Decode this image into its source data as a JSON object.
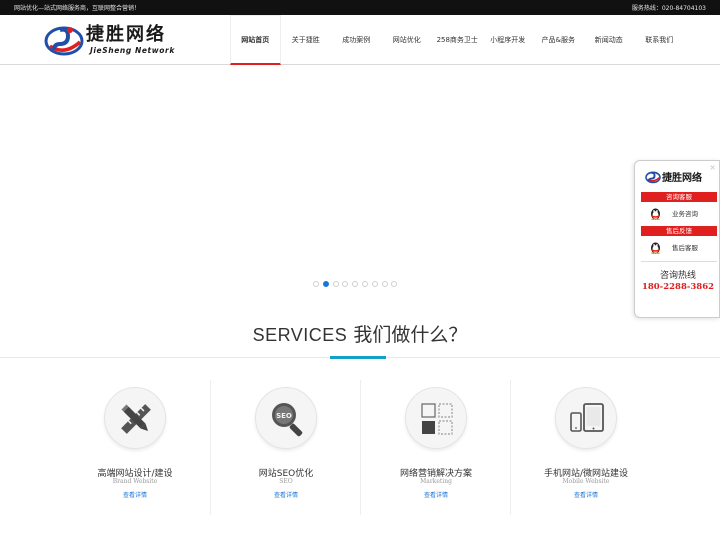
{
  "topbar": {
    "slogan": "网站优化—站式网络服务商，互联网整合营销！",
    "hotline": "服务热线：020-84704103"
  },
  "logo": {
    "cn": "捷胜网络",
    "en": "JieSheng Network"
  },
  "nav": {
    "items": [
      {
        "label": "网站首页",
        "active": true
      },
      {
        "label": "关于捷胜"
      },
      {
        "label": "成功案例"
      },
      {
        "label": "网站优化"
      },
      {
        "label": "258商务卫士"
      },
      {
        "label": "小程序开发"
      },
      {
        "label": "产品&服务"
      },
      {
        "label": "新闻动态"
      },
      {
        "label": "联系我们"
      }
    ]
  },
  "slider": {
    "dot_count": 9,
    "active_index": 1
  },
  "services": {
    "title_en": "SERVICES",
    "title_cn": "我们做什么？",
    "items": [
      {
        "name": "高端网站设计/建设",
        "en": "Brand Website",
        "more": "查看详情",
        "icon": "pencil-ruler-icon"
      },
      {
        "name": "网站SEO优化",
        "en": "SEO",
        "more": "查看详情",
        "icon": "seo-magnifier-icon"
      },
      {
        "name": "网络营销解决方案",
        "en": "Marketing",
        "more": "查看详情",
        "icon": "grid-squares-icon"
      },
      {
        "name": "手机网站/微网站建设",
        "en": "Mobile Website",
        "more": "查看详情",
        "icon": "mobile-tablet-icon"
      }
    ]
  },
  "side_panel": {
    "logo_cn": "捷胜网络",
    "close": "×",
    "consult_header": "咨询客服",
    "consult_label": "业务咨询",
    "after_header": "售后反馈",
    "after_label": "售后客服",
    "hotline_label": "咨询热线",
    "hotline_number": "180-2288-3862"
  },
  "colors": {
    "accent_red": "#e0201f",
    "accent_blue": "#1a74d9",
    "accent_teal": "#13a1c8",
    "topbar": "#111111"
  }
}
